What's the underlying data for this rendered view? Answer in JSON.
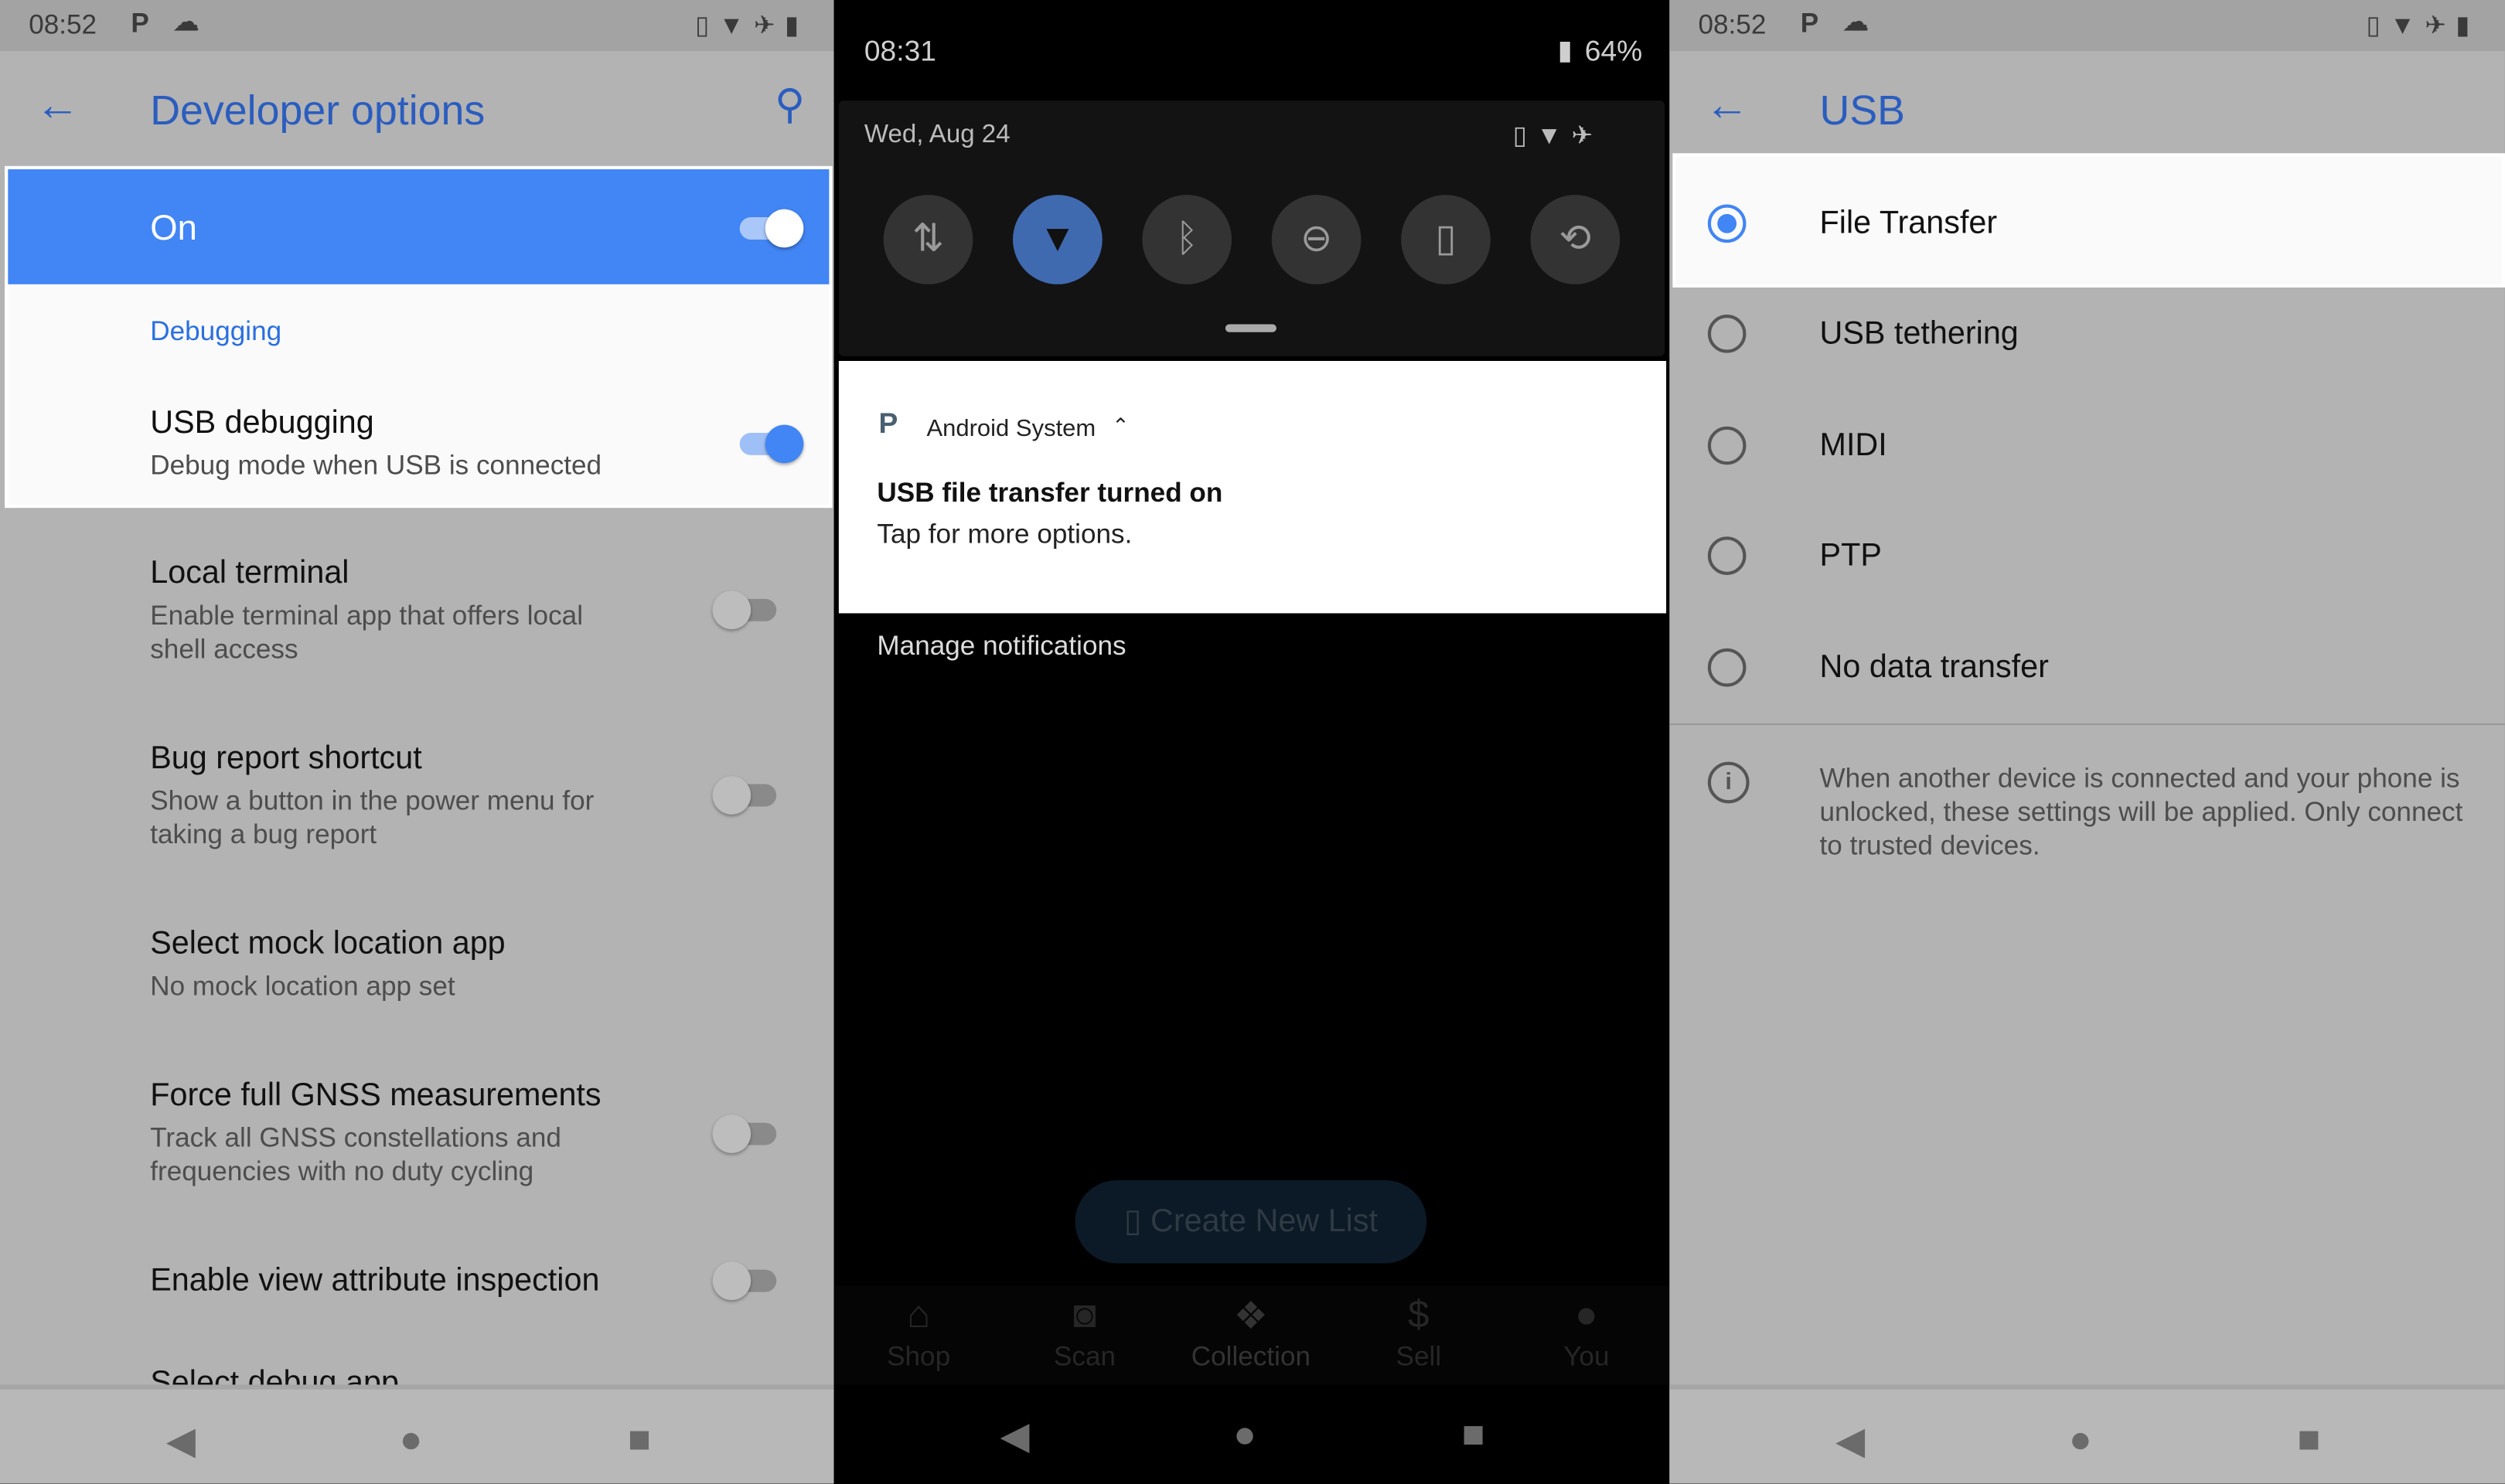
{
  "left": {
    "status": {
      "time": "08:52",
      "icons": [
        "parking-icon",
        "cloud-icon",
        "vibrate-icon",
        "wifi-icon",
        "airplane-icon",
        "battery-icon"
      ]
    },
    "title": "Developer options",
    "master": {
      "label": "On",
      "checked": true
    },
    "section": "Debugging",
    "items": [
      {
        "title": "USB debugging",
        "subtitle": "Debug mode when USB is connected",
        "checked": true
      },
      {
        "title": "Local terminal",
        "subtitle": "Enable terminal app that offers local shell access",
        "checked": false
      },
      {
        "title": "Bug report shortcut",
        "subtitle": "Show a button in the power menu for taking a bug report",
        "checked": false
      },
      {
        "title": "Select mock location app",
        "subtitle": "No mock location app set"
      },
      {
        "title": "Force full GNSS measurements",
        "subtitle": "Track all GNSS constellations and frequencies with no duty cycling",
        "checked": false
      },
      {
        "title": "Enable view attribute inspection",
        "checked": false
      }
    ],
    "cut_item": "Select debug app"
  },
  "middle": {
    "time": "08:31",
    "battery": "64%",
    "date": "Wed, Aug 24",
    "tiles": [
      {
        "icon": "mobile-data-icon",
        "active": false
      },
      {
        "icon": "wifi-icon",
        "active": true
      },
      {
        "icon": "bluetooth-icon",
        "active": false
      },
      {
        "icon": "do-not-disturb-icon",
        "active": false
      },
      {
        "icon": "flashlight-icon",
        "active": false
      },
      {
        "icon": "auto-rotate-icon",
        "active": false
      }
    ],
    "notification": {
      "app": "Android System",
      "title": "USB file transfer turned on",
      "text": "Tap for more options."
    },
    "manage": "Manage notifications",
    "background_app": {
      "button": "Create New List",
      "tabs": [
        {
          "label": "Shop"
        },
        {
          "label": "Scan"
        },
        {
          "label": "Collection"
        },
        {
          "label": "Sell"
        },
        {
          "label": "You"
        }
      ]
    }
  },
  "right": {
    "status": {
      "time": "08:52"
    },
    "title": "USB",
    "options": [
      {
        "label": "File Transfer",
        "selected": true
      },
      {
        "label": "USB tethering",
        "selected": false
      },
      {
        "label": "MIDI",
        "selected": false
      },
      {
        "label": "PTP",
        "selected": false
      },
      {
        "label": "No data transfer",
        "selected": false
      }
    ],
    "info": "When another device is connected and your phone is unlocked, these settings will be applied. Only connect to trusted devices."
  },
  "colors": {
    "accent": "#4285f4",
    "title_blue": "#2a5dbf",
    "tile_active": "#406ab0"
  }
}
